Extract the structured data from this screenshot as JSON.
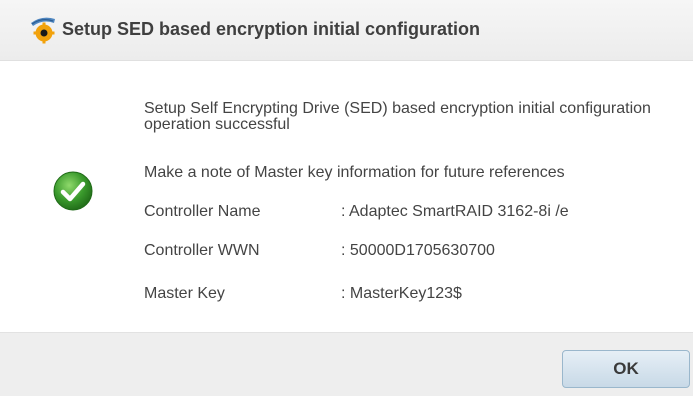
{
  "dialog": {
    "title": "Setup SED based encryption initial configuration",
    "title_icon": "shield-gear-icon",
    "status_icon": "success-check-icon",
    "message": "Setup Self Encrypting Drive (SED) based encryption initial configuration operation successful",
    "note": "Make a note of Master key information for future references",
    "info": [
      {
        "label": "Controller Name",
        "value": ": Adaptec SmartRAID 3162-8i /e"
      },
      {
        "label": "Controller WWN",
        "value": ": 50000D1705630700"
      },
      {
        "label": "Master Key",
        "value": ": MasterKey123$"
      }
    ],
    "ok_label": "OK"
  },
  "colors": {
    "success_green": "#3a9a2c",
    "title_bar": "#ececec",
    "footer": "#eeeeee",
    "button_gradient_top": "#e6eff6",
    "button_gradient_bottom": "#c8d9e7"
  }
}
